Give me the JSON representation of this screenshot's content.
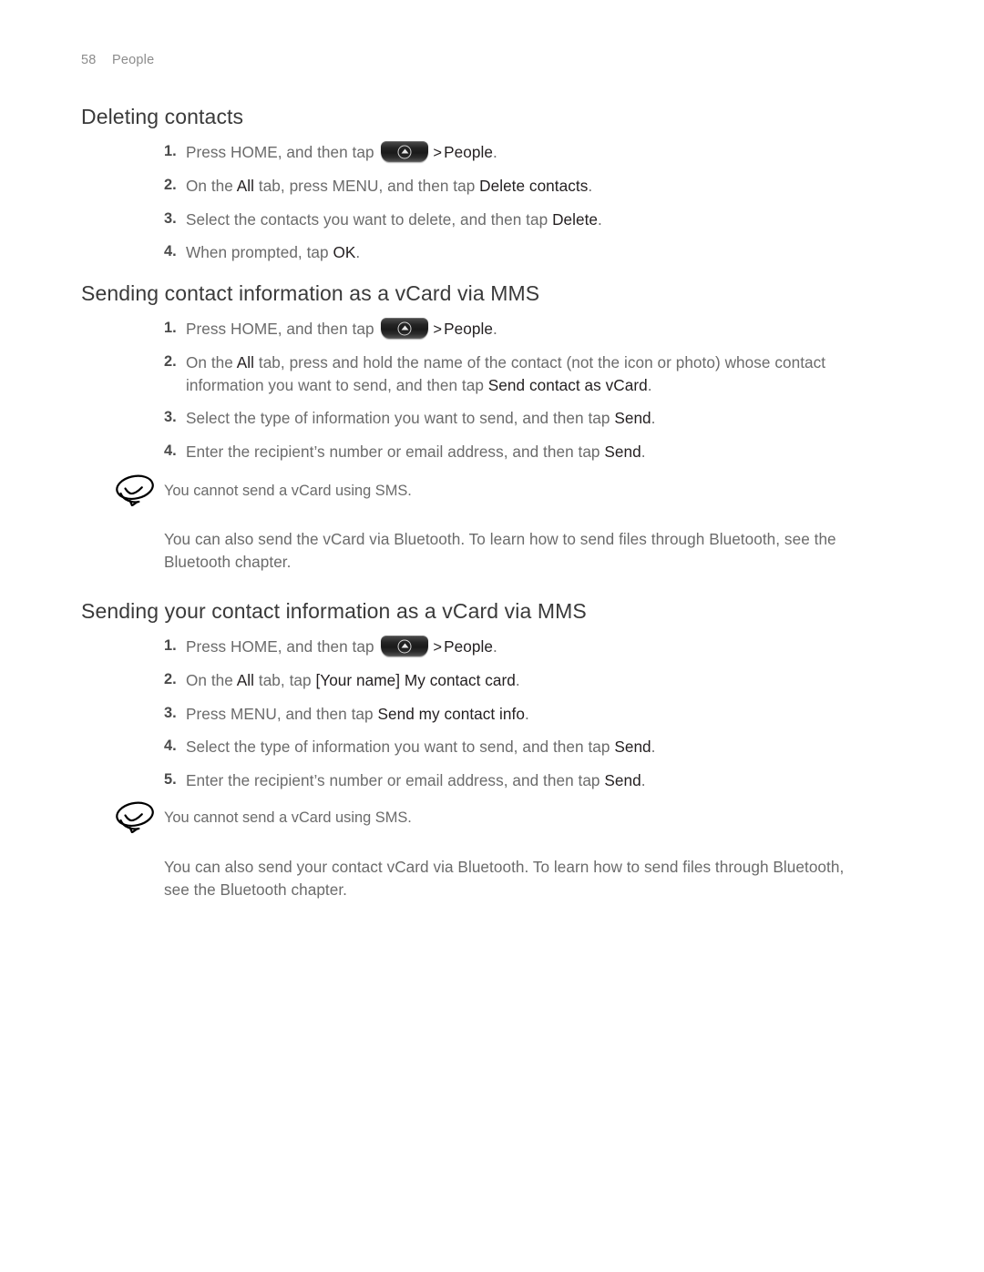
{
  "page": {
    "number": "58",
    "section": "People",
    "background": "#ffffff",
    "body_text_color": "#6b6b6b",
    "heading_color": "#3a3a3a",
    "highlight_color": "#231f20",
    "header_color": "#8c8c8c"
  },
  "icons": {
    "home_key": "home-hardkey-icon",
    "note": "note-speech-bubble-icon",
    "chevron": ">"
  },
  "sections": [
    {
      "id": "deleting-contacts",
      "heading": "Deleting contacts",
      "steps": [
        {
          "num": "1.",
          "parts": [
            {
              "t": "text",
              "v": "Press HOME, and then tap "
            },
            {
              "t": "home-key"
            },
            {
              "t": "chev",
              "v": ">"
            },
            {
              "t": "hl",
              "v": "People"
            },
            {
              "t": "text",
              "v": "."
            }
          ]
        },
        {
          "num": "2.",
          "parts": [
            {
              "t": "text",
              "v": "On the "
            },
            {
              "t": "hl",
              "v": "All"
            },
            {
              "t": "text",
              "v": " tab, press MENU, and then tap "
            },
            {
              "t": "hl",
              "v": "Delete contacts"
            },
            {
              "t": "text",
              "v": "."
            }
          ]
        },
        {
          "num": "3.",
          "parts": [
            {
              "t": "text",
              "v": "Select the contacts you want to delete, and then tap "
            },
            {
              "t": "hl",
              "v": "Delete"
            },
            {
              "t": "text",
              "v": "."
            }
          ]
        },
        {
          "num": "4.",
          "parts": [
            {
              "t": "text",
              "v": "When prompted, tap "
            },
            {
              "t": "hl",
              "v": "OK"
            },
            {
              "t": "text",
              "v": "."
            }
          ]
        }
      ]
    },
    {
      "id": "sending-contact-information-vcard-mms",
      "heading": "Sending contact information as a vCard via MMS",
      "steps": [
        {
          "num": "1.",
          "parts": [
            {
              "t": "text",
              "v": "Press HOME, and then tap "
            },
            {
              "t": "home-key"
            },
            {
              "t": "chev",
              "v": ">"
            },
            {
              "t": "hl",
              "v": "People"
            },
            {
              "t": "text",
              "v": "."
            }
          ]
        },
        {
          "num": "2.",
          "parts": [
            {
              "t": "text",
              "v": "On the "
            },
            {
              "t": "hl",
              "v": "All"
            },
            {
              "t": "text",
              "v": " tab, press and hold the name of the contact (not the icon or photo) whose contact information you want to send, and then tap "
            },
            {
              "t": "hl",
              "v": "Send contact as vCard"
            },
            {
              "t": "text",
              "v": "."
            }
          ]
        },
        {
          "num": "3.",
          "parts": [
            {
              "t": "text",
              "v": "Select the type of information you want to send, and then tap "
            },
            {
              "t": "hl",
              "v": "Send"
            },
            {
              "t": "text",
              "v": "."
            }
          ]
        },
        {
          "num": "4.",
          "parts": [
            {
              "t": "text",
              "v": "Enter the recipient’s number or email address, and then tap "
            },
            {
              "t": "hl",
              "v": "Send"
            },
            {
              "t": "text",
              "v": "."
            }
          ]
        }
      ],
      "note": "You cannot send a vCard using SMS.",
      "paragraph": "You can also send the vCard via Bluetooth. To learn how to send files through Bluetooth, see the Bluetooth chapter."
    },
    {
      "id": "sending-your-contact-information-vcard-mms",
      "heading": "Sending your contact information as a vCard via MMS",
      "steps": [
        {
          "num": "1.",
          "parts": [
            {
              "t": "text",
              "v": "Press HOME, and then tap "
            },
            {
              "t": "home-key"
            },
            {
              "t": "chev",
              "v": ">"
            },
            {
              "t": "hl",
              "v": "People"
            },
            {
              "t": "text",
              "v": "."
            }
          ]
        },
        {
          "num": "2.",
          "parts": [
            {
              "t": "text",
              "v": "On the "
            },
            {
              "t": "hl",
              "v": "All"
            },
            {
              "t": "text",
              "v": " tab, tap "
            },
            {
              "t": "hl",
              "v": "[Your name] My contact card"
            },
            {
              "t": "text",
              "v": "."
            }
          ]
        },
        {
          "num": "3.",
          "parts": [
            {
              "t": "text",
              "v": "Press MENU, and then tap "
            },
            {
              "t": "hl",
              "v": "Send my contact info"
            },
            {
              "t": "text",
              "v": "."
            }
          ]
        },
        {
          "num": "4.",
          "parts": [
            {
              "t": "text",
              "v": "Select the type of information you want to send, and then tap "
            },
            {
              "t": "hl",
              "v": "Send"
            },
            {
              "t": "text",
              "v": "."
            }
          ]
        },
        {
          "num": "5.",
          "parts": [
            {
              "t": "text",
              "v": "Enter the recipient’s number or email address, and then tap "
            },
            {
              "t": "hl",
              "v": "Send"
            },
            {
              "t": "text",
              "v": "."
            }
          ]
        }
      ],
      "note": "You cannot send a vCard using SMS.",
      "paragraph": "You can also send your contact vCard via Bluetooth. To learn how to send files through Bluetooth, see the Bluetooth chapter."
    }
  ]
}
